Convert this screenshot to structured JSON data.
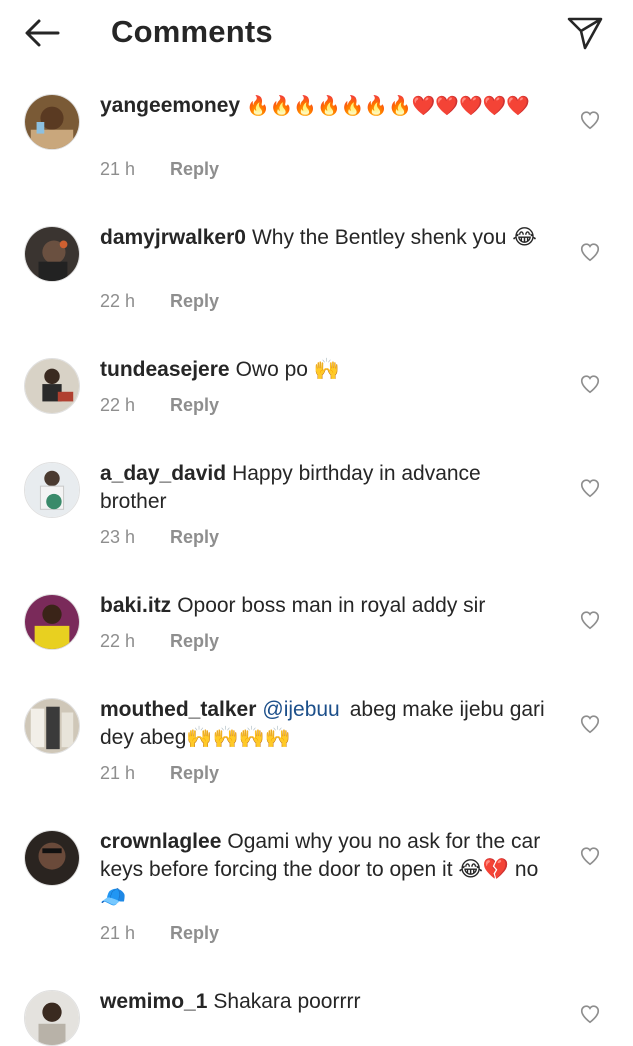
{
  "header": {
    "title": "Comments",
    "back_icon": "arrow-left-icon",
    "share_icon": "paper-plane-icon"
  },
  "reply_label": "Reply",
  "comments": [
    {
      "username": "yangeemoney",
      "text": "🔥🔥🔥🔥🔥🔥🔥❤️❤️❤️❤️❤️",
      "time": "21 h"
    },
    {
      "username": "damyjrwalker0",
      "text": "Why the Bentley shenk you 😂",
      "time": "22 h"
    },
    {
      "username": "tundeasejere",
      "text": "Owo po 🙌",
      "time": "22 h"
    },
    {
      "username": "a_day_david",
      "text": "Happy birthday in advance brother",
      "time": "23 h"
    },
    {
      "username": "baki.itz",
      "text": "Opoor boss man in royal addy sir",
      "time": "22 h"
    },
    {
      "username": "mouthed_talker",
      "mention": "@ijebuu",
      "text": "abeg make ijebu gari dey abeg🙌🙌🙌🙌",
      "time": "21 h"
    },
    {
      "username": "crownlaglee",
      "text": "Ogami why you no ask for the car keys before forcing the door to open it 😂💔 no 🧢",
      "time": "21 h"
    },
    {
      "username": "wemimo_1",
      "text": "Shakara poorrrr",
      "time": ""
    }
  ]
}
